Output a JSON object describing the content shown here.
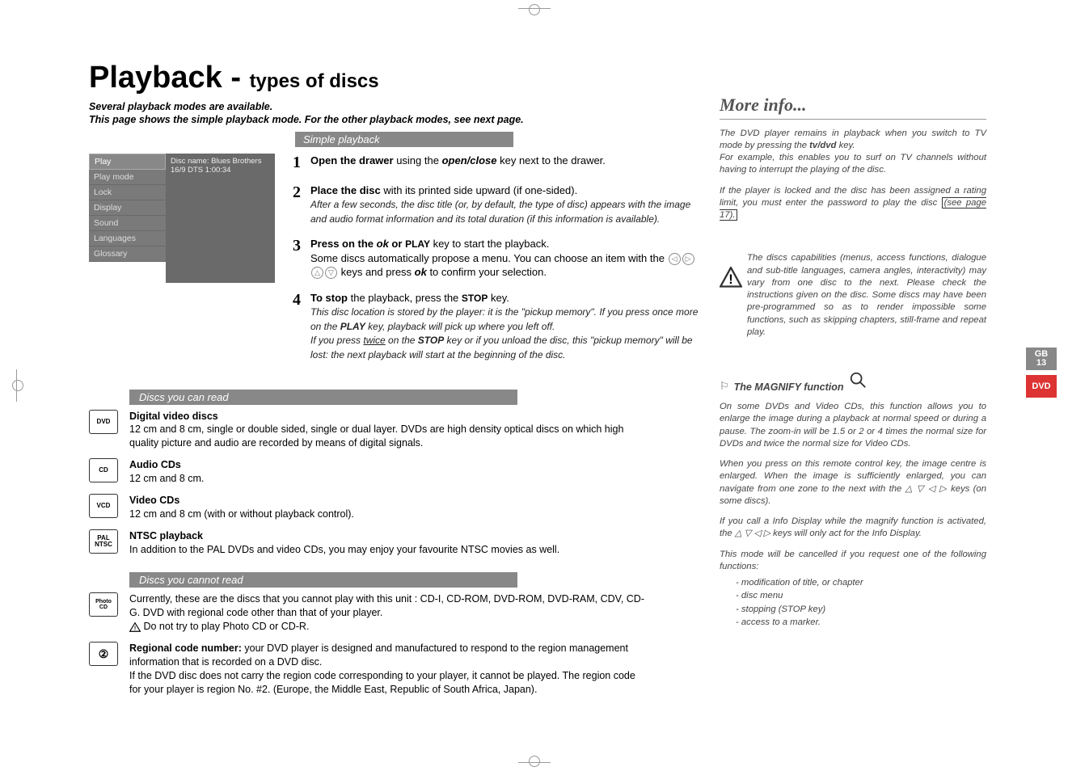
{
  "header": {
    "title_main": "Playback - ",
    "title_sub": "types of discs",
    "intro_line1": "Several playback modes are available.",
    "intro_line2": "This page shows the simple playback mode. For the other playback modes, see next page."
  },
  "simple": {
    "header": "Simple playback",
    "menu": {
      "items": [
        "Play",
        "Play mode",
        "Lock",
        "Display",
        "Sound",
        "Languages",
        "Glossary"
      ],
      "detail_line1": "Disc name: Blues Brothers",
      "detail_line2": "16/9 DTS 1:00:34"
    },
    "steps": [
      {
        "num": "1",
        "html": "<b>Open the drawer</b> using the <b><i>open/close</i></b> key next to the drawer."
      },
      {
        "num": "2",
        "html": "<b>Place the disc</b> with its printed side upward (if one-sided).<br><span class='note'>After a few seconds, the disc title (or, by default, the type of disc) appears with the image and audio format information and its total duration (if this information is available).</span>"
      },
      {
        "num": "3",
        "html": "<b>Press on the <i>ok</i> or</b> <span class='smallcaps'>PLAY</span> key to start the playback.<br>Some discs automatically propose a menu. You can choose an item with the <span class='arrow-icon' data-name='left-icon'>◁</span><span class='arrow-icon' data-name='right-icon'>▷</span><span class='arrow-icon' data-name='up-icon'>△</span><span class='arrow-icon' data-name='down-icon'>▽</span> keys and press <b><i>ok</i></b> to confirm your selection."
      },
      {
        "num": "4",
        "html": "<b>To stop</b> the playback, press the <span class='smallcaps'>STOP</span> key.<br><span class='note'>This disc location is stored by the player: it is the \"pickup memory\". If you press once more on the <span class='smallcaps'>PLAY</span> key, playback will pick up where you left off.<br>If you press <u>twice</u> on the <span class='smallcaps'>STOP</span> key or if you unload the disc, this \"pickup memory\" will be lost: the next playback will start at the beginning of the disc.</span>"
      }
    ]
  },
  "discs_read": {
    "header": "Discs you can read",
    "items": [
      {
        "icon": "DVD",
        "title": "Digital video discs",
        "body": "12 cm and 8 cm, single or double sided, single or dual layer. DVDs are high density optical discs on which high quality picture and audio are recorded by means of digital signals."
      },
      {
        "icon": "CD",
        "title": "Audio CDs",
        "body": "12 cm and 8 cm."
      },
      {
        "icon": "VCD",
        "title": "Video CDs",
        "body": "12 cm and 8 cm (with or without playback control)."
      },
      {
        "icon": "PAL\nNTSC",
        "title": "NTSC playback",
        "body": "In addition to the PAL DVDs and video CDs, you may enjoy your favourite NTSC movies as well."
      }
    ]
  },
  "discs_noread": {
    "header": "Discs you cannot read",
    "item1_body": "Currently, these are the discs that you cannot play with this unit : CD-I, CD-ROM, DVD-ROM, DVD-RAM, CDV, CD-G. DVD with regional code other than that of your player.",
    "item1_warn": "Do not try to play Photo CD or CD-R.",
    "item2_lead": "Regional code number:",
    "item2_body": " your DVD player is designed and manufactured to respond to the region management information that is recorded on a DVD disc.",
    "item2_more": "If the DVD disc does not carry the region code corresponding to your player, it cannot be played. The region code for your player is region No. #2. (Europe, the Middle East, Republic of South Africa, Japan)."
  },
  "moreinfo": {
    "title": "More info...",
    "p1": "The DVD player remains in playback when you switch to TV mode by pressing the <b>tv/dvd</b> key.",
    "p1b": "For example, this enables you to surf on TV channels without having to interrupt the playing of the disc.",
    "p2a": "If the player is locked and the disc has been assigned a rating limit, you must enter the password to play the disc ",
    "p2b_boxed": "(see page 17).",
    "warn": "The discs capabilities (menus, access functions, dialogue and sub-title languages, camera angles, interactivity) may vary from one disc to the next. Please check the instructions given on the disc. Some discs may have been pre-programmed so as to render impossible some functions, such as skipping chapters, still-frame and repeat play.",
    "magnify_label": "The MAGNIFY function",
    "mag_p1": "On some DVDs and Video CDs, this function allows you to enlarge the image during a playback at normal speed or during a pause. The zoom-in will be 1.5 or 2 or 4 times the normal size for DVDs and twice the normal size for Video CDs.",
    "mag_p2": "When you press on this remote control key, the image centre is enlarged. When the image is sufficiently enlarged, you can navigate from one zone to the next with the △ ▽ ◁ ▷ keys (on some discs).",
    "mag_p3": "If you call a Info Display while the magnify function is activated, the △ ▽ ◁ ▷ keys will only act for the Info Display.",
    "mag_p4": "This mode will be cancelled if you request one of the following functions:",
    "mag_list": [
      "- modification of title, or chapter",
      "- disc menu",
      "- stopping (STOP key)",
      "- access to a marker."
    ]
  },
  "sidetabs": {
    "gb": "GB",
    "page": "13",
    "dvd": "DVD"
  }
}
